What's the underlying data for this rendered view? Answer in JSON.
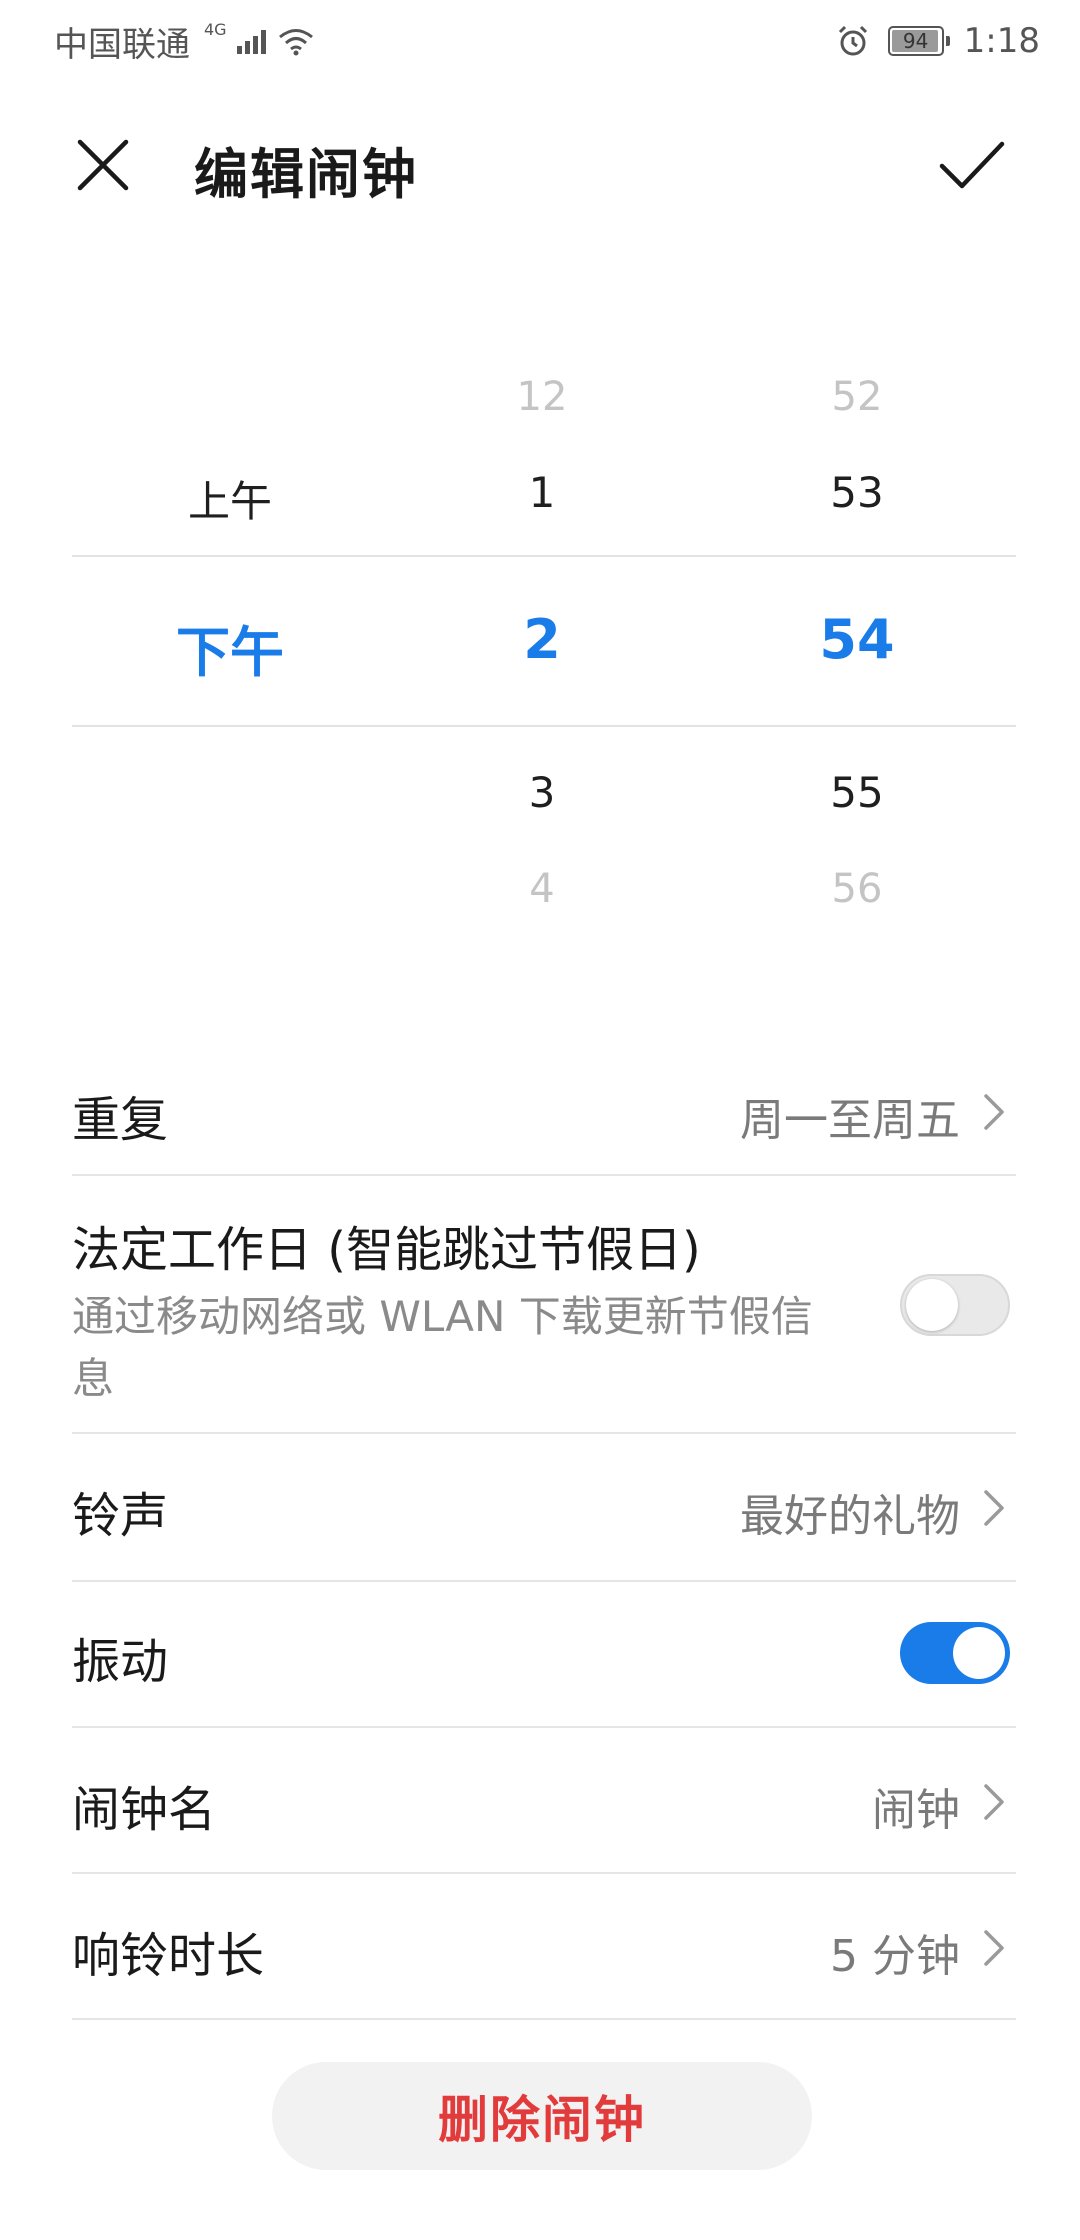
{
  "status_bar": {
    "carrier": "中国联通",
    "network_type": "4G",
    "battery": "94",
    "time": "1:18"
  },
  "header": {
    "title": "编辑闹钟"
  },
  "picker": {
    "ampm": {
      "near_prev": "上午",
      "selected": "下午"
    },
    "hour": {
      "far_prev": "12",
      "near_prev": "1",
      "selected": "2",
      "near_next": "3",
      "far_next": "4"
    },
    "minute": {
      "far_prev": "52",
      "near_prev": "53",
      "selected": "54",
      "near_next": "55",
      "far_next": "56"
    }
  },
  "settings": {
    "repeat": {
      "label": "重复",
      "value": "周一至周五"
    },
    "workday": {
      "label": "法定工作日 (智能跳过节假日)",
      "description": "通过移动网络或 WLAN 下载更新节假信息",
      "enabled": false
    },
    "ringtone": {
      "label": "铃声",
      "value": "最好的礼物"
    },
    "vibrate": {
      "label": "振动",
      "enabled": true
    },
    "alarm_name": {
      "label": "闹钟名",
      "value": "闹钟"
    },
    "ring_duration": {
      "label": "响铃时长",
      "value": "5 分钟"
    }
  },
  "actions": {
    "delete_label": "删除闹钟"
  },
  "colors": {
    "accent": "#1a7ce8",
    "danger": "#e23b3b"
  }
}
